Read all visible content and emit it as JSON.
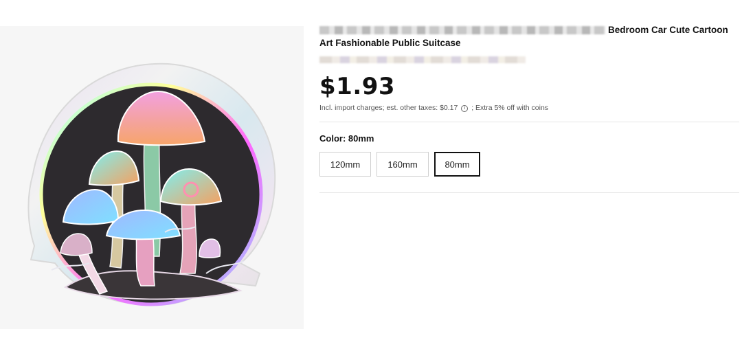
{
  "product": {
    "title_end": "Bedroom Car Cute Cartoon",
    "title_line2": "Art Fashionable Public Suitcase",
    "image_alt": "holographic mushroom sticker"
  },
  "pricing": {
    "price": "$1.93",
    "tax_prefix": "Incl. import charges; est. other taxes: $0.17",
    "tax_suffix": "; Extra 5% off with coins",
    "info_icon": "info-icon"
  },
  "variants": {
    "label": "Color: 80mm",
    "options": [
      {
        "label": "120mm",
        "selected": false
      },
      {
        "label": "160mm",
        "selected": false
      },
      {
        "label": "80mm",
        "selected": true
      }
    ]
  }
}
